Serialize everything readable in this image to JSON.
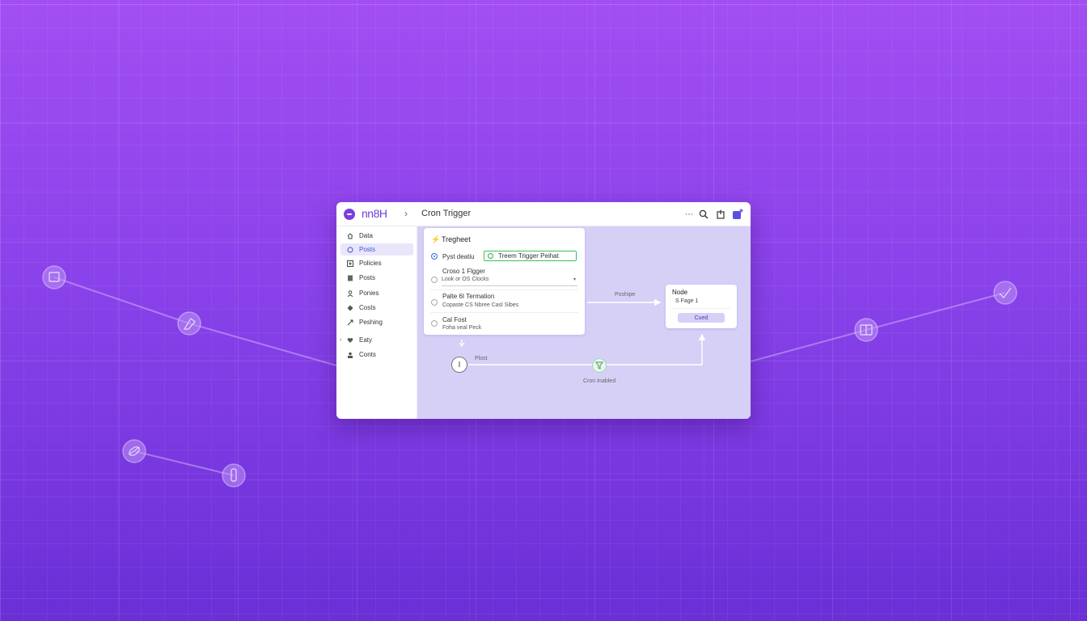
{
  "app": {
    "brand": "nn8H",
    "breadcrumb_separator": "›",
    "workflow_title": "Cron Trigger"
  },
  "toolbar": {
    "more": "···",
    "icons": [
      "more-icon",
      "search-icon",
      "share-icon",
      "notification-icon"
    ]
  },
  "sidebar": {
    "items": [
      {
        "label": "Data",
        "icon": "home-icon",
        "active": false
      },
      {
        "label": "Posts",
        "icon": "circle-icon",
        "active": true
      },
      {
        "label": "Policies",
        "icon": "plus-square-icon",
        "active": false
      },
      {
        "label": "Posts",
        "icon": "document-icon",
        "active": false
      },
      {
        "label": "Ponies",
        "icon": "user-icon",
        "active": false
      },
      {
        "label": "Costs",
        "icon": "diamond-icon",
        "active": false
      },
      {
        "label": "Peshing",
        "icon": "link-icon",
        "active": false
      },
      {
        "label": "Eaty",
        "icon": "heart-icon",
        "active": false,
        "expandable": true
      },
      {
        "label": "Conts",
        "icon": "contacts-icon",
        "active": false
      }
    ]
  },
  "trigger_panel": {
    "title": "Tregheet",
    "option1": {
      "label": "Pyst deatiu",
      "input_value": "Treem Trigger Peihat"
    },
    "option2": {
      "label": "Croso 1 Flgger",
      "select_value": "Look or OS Clocks"
    },
    "option3": {
      "label": "Palte 6I Termation",
      "sub": "Copaste CS Nbree Casl Sibes"
    },
    "option4": {
      "label": "Cal Fost",
      "sub": "Foha veal Peck"
    }
  },
  "flow": {
    "arrow_label": "Poshipe",
    "start_symbol": "I",
    "start_label": "Plost",
    "filter_label": "Cron Inabled"
  },
  "node_card": {
    "title": "Node",
    "sub": "S  Fage 1",
    "button": "Cued"
  }
}
